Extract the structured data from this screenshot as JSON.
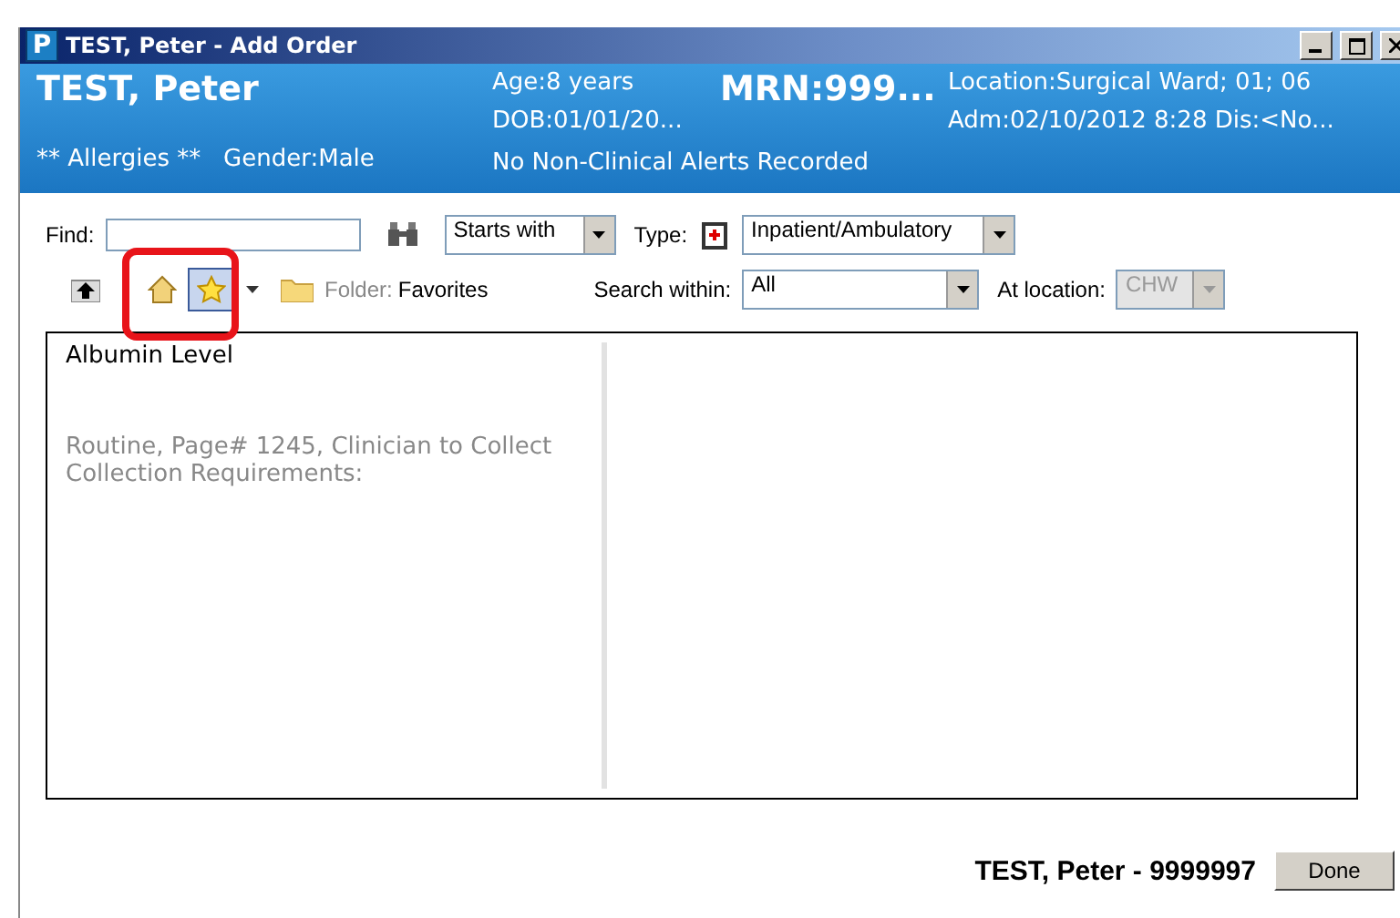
{
  "window": {
    "title": "TEST, Peter - Add Order",
    "logo": "P"
  },
  "banner": {
    "name": "TEST, Peter",
    "allergies": "** Allergies **",
    "gender": "Gender:Male",
    "age": "Age:8 years",
    "dob": "DOB:01/01/20...",
    "mrn": "MRN:999...",
    "alerts": "No Non-Clinical Alerts Recorded",
    "location": "Location:Surgical Ward; 01; 06",
    "admission": "Adm:02/10/2012 8:28 Dis:<No..."
  },
  "search": {
    "find_label": "Find:",
    "match": "Starts with",
    "type_label": "Type:",
    "type": "Inpatient/Ambulatory",
    "folder_label": "Folder:",
    "folder": "Favorites",
    "within_label": "Search within:",
    "within": "All",
    "location_label": "At location:",
    "location": "CHW",
    "location_disabled": true
  },
  "order": {
    "name": "Albumin Level",
    "details": [
      "Routine, Page# 1245, Clinician to Collect",
      "Collection Requirements:"
    ]
  },
  "footer": {
    "patient": "TEST, Peter - 9999997",
    "button": "Done"
  }
}
